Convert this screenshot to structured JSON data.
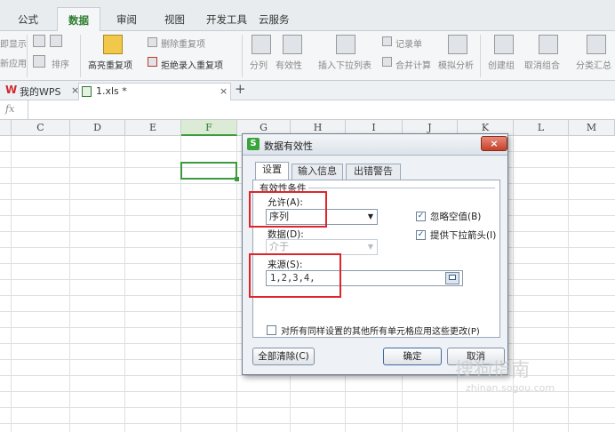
{
  "ribbon_tabs": [
    "公式",
    "数据",
    "审阅",
    "视图",
    "开发工具",
    "云服务"
  ],
  "active_tab": "数据",
  "ribbon": {
    "partial_left_1": "即显示",
    "partial_left_2": "新应用",
    "sort": "排序",
    "highlight_dup": "高亮重复项",
    "remove_dup": "删除重复项",
    "reject_dup": "拒绝录入重复项",
    "split": "分列",
    "validity": "有效性",
    "insert_dropdown": "插入下拉列表",
    "record": "记录单",
    "consolidate": "合并计算",
    "simulate": "模拟分析",
    "group": "创建组",
    "ungroup": "取消组合",
    "subtotal": "分类汇总"
  },
  "doc_tabs": {
    "wps": "我的WPS",
    "file": "1.xls *",
    "add": "+"
  },
  "formula_bar": {
    "fx": "fx"
  },
  "columns": [
    "C",
    "D",
    "E",
    "F",
    "G",
    "H",
    "I",
    "J",
    "K",
    "L",
    "M"
  ],
  "selected_column": "F",
  "dialog": {
    "title": "数据有效性",
    "close": "×",
    "tabs": [
      "设置",
      "输入信息",
      "出错警告"
    ],
    "group_label": "有效性条件",
    "allow_label": "允许(A):",
    "allow_value": "序列",
    "ignore_blank": "忽略空值(B)",
    "ignore_blank_checked": true,
    "data_label": "数据(D):",
    "data_value": "介于",
    "dropdown_arrow": "提供下拉箭头(I)",
    "dropdown_arrow_checked": true,
    "source_label": "来源(S):",
    "source_value": "1,2,3,4,",
    "apply_all": "对所有同样设置的其他所有单元格应用这些更改(P)",
    "apply_all_checked": false,
    "btn_clear": "全部清除(C)",
    "btn_ok": "确定",
    "btn_cancel": "取消"
  },
  "watermark": {
    "line1": "搜狗指南",
    "line2": "zhinan.sogou.com"
  },
  "colors": {
    "active_green": "#2d7c2f",
    "highlight_red": "#e0252a",
    "dialog_bg": "#eef1f5"
  }
}
